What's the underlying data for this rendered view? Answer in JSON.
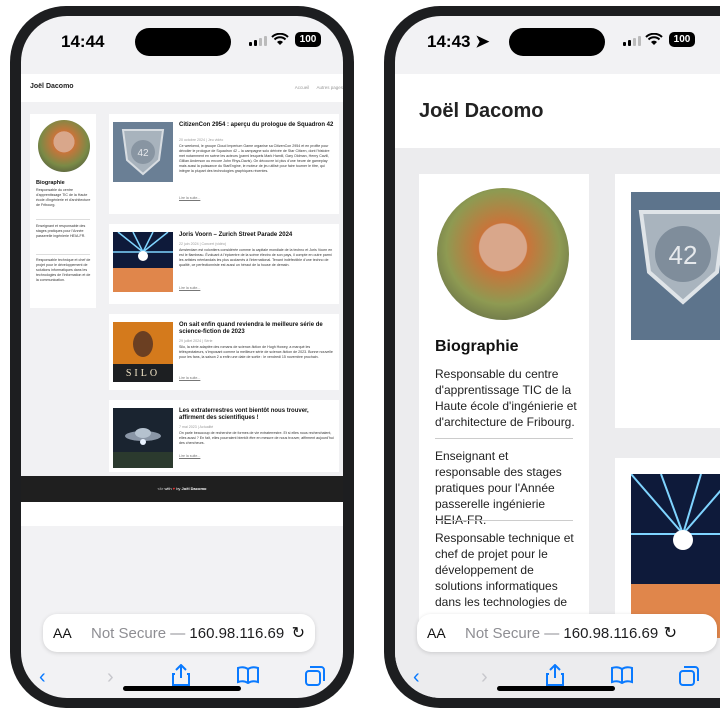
{
  "left_phone": {
    "status_time": "14:44",
    "battery": "100",
    "site_title": "Joël Dacomo",
    "nav": [
      "Accueil",
      "Autres pages"
    ],
    "sidebar": {
      "heading": "Biographie",
      "paragraphs": [
        "Responsable du centre d'apprentissage TIC de la Haute école d'ingénierie et d'architecture de Fribourg.",
        "Enseignant et responsable des stages pratiques pour l'Année passerelle ingénierie HEIA-FR.",
        "Responsable technique et chef de projet pour le développement de solutions informatiques dans les technologies de l'information et de la communication."
      ]
    },
    "posts": [
      {
        "title": "CitizenCon 2954 : aperçu du prologue de Squadron 42",
        "date": "20 octobre 2024",
        "category": "Jeu vidéo",
        "excerpt": "Ce weekend, le groupe Cloud Imperium Game organise sa CitizenCon 2954 et en profite pour dévoiler le prologue de Squadron 42 – la campagne solo dérivée de Star Citizen, dont l'histoire met notamment en scène les acteurs (parmi lesquels Mark Hamill, Gary Oldman, Henry Cavill, Gillian Anderson ou encore John Rhys-Davis). On découvre ici plus d'une heure de gameplay mais aussi la puissance du StarEngine, le moteur de jeu utilisé pour faire tourner le titre, qui intègre la plupart des technologies graphiques récentes.",
        "more": "Lire la suite..."
      },
      {
        "title": "Joris Voorn – Zurich Street Parade 2024",
        "date": "22 juin 2024",
        "category": "Concert (vidéo)",
        "excerpt": "Amsterdam est volontiers considérée comme la capitale mondiale de la techno et Joris Voorn en est le flambeau. Évoluant à l'épicentre de la scène électro de son pays, il compte en outre parmi les artistes néerlandais les plus acclamés à l'international. Tenant indéfectible d'une techno de qualité, ce perfectionniste est aussi un héraut de la house de demain.",
        "more": "Lire la suite..."
      },
      {
        "title": "On sait enfin quand reviendra le meilleure série de science-fiction de 2023",
        "date": "29 juillet 2024",
        "category": "Série",
        "excerpt": "Silo, la série adaptée des romans de science-fiction de Hugh Howey, a marqué les téléspectateurs, s'imposant comme la meilleure série de science-fiction de 2023. Bonne nouvelle pour les fans, la saison 2 a enfin une date de sortie : le vendredi 15 novembre prochain.",
        "more": "Lire la suite..."
      },
      {
        "title": "Les extraterrestres vont bientôt nous trouver, affirment des scientifiques !",
        "date": "7 mai 2023",
        "category": "Actualité",
        "excerpt": "On parle beaucoup de recherche de formes de vie extraterrestre. Et si elles nous recherchaient, elles aussi ? En fait, elles pourraient bientôt être en mesure de nous trouver, affirment aujourd'hui des chercheurs.",
        "more": "Lire la suite..."
      }
    ],
    "footer": {
      "prefix": "</> with",
      "by": "by",
      "author": "Joël Dacomo"
    },
    "address_bar": {
      "aa": "AA",
      "not_secure": "Not Secure —",
      "host": "160.98.116.69"
    }
  },
  "right_phone": {
    "status_time": "14:43",
    "battery": "100",
    "site_title": "Joël Dacomo",
    "sidebar": {
      "heading": "Biographie",
      "paragraphs": [
        "Responsable du centre d'apprentissage TIC de la Haute école d'ingénierie et d'architecture de Fribourg.",
        "Enseignant et responsable des stages pratiques pour l'Année passerelle ingénierie HEIA-FR.",
        "Responsable technique et chef de projet pour le développement de solutions informatiques dans les technologies de"
      ]
    },
    "address_bar": {
      "aa": "AA",
      "not_secure": "Not Secure —",
      "host": "160.98.116.69"
    }
  },
  "colors": {
    "link_blue": "#0a7aff",
    "page_bg": "#f1f1f3",
    "footer_bg": "#1f1f1f",
    "heart": "#e33333"
  }
}
